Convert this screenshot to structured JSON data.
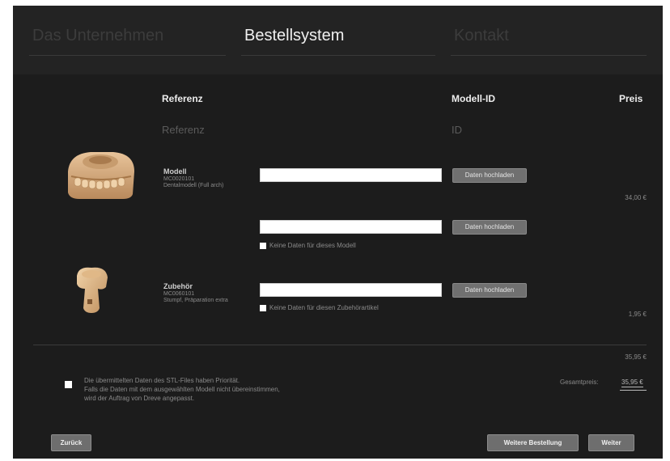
{
  "nav": {
    "tabs": [
      {
        "label": "Das Unternehmen",
        "active": false
      },
      {
        "label": "Bestellsystem",
        "active": true
      },
      {
        "label": "Kontakt",
        "active": false
      }
    ]
  },
  "table": {
    "header": {
      "ref": "Referenz",
      "model_id": "Modell-ID",
      "price": "Preis"
    },
    "sub": {
      "ref": "Referenz",
      "id": "ID"
    }
  },
  "items": [
    {
      "name": "Modell",
      "code": "MC0020101",
      "desc": "Dentalmodell (Full arch)",
      "upload_label": "Daten hochladen",
      "upload_label_2": "Daten hochladen",
      "no_data_label": "Keine Daten für dieses Modell",
      "price": "34,00 €"
    },
    {
      "name": "Zubehör",
      "code": "MC0060101",
      "desc": "Stumpf, Präparation extra",
      "upload_label": "Daten hochladen",
      "no_data_label": "Keine Daten für diesen Zubehörartikel",
      "price": "1,95 €"
    }
  ],
  "summary": {
    "subtotal": "35,95 €",
    "note_lines": [
      "Die übermittelten Daten des STL-Files haben Priorität.",
      "Falls die Daten mit dem ausgewählten Modell nicht übereinstimmen,",
      "wird der Auftrag von Dreve angepasst."
    ],
    "grand_label": "Gesamtpreis:",
    "grand_value": "35,95 €"
  },
  "buttons": {
    "back": "Zurück",
    "more": "Weitere Bestellung",
    "next": "Weiter"
  },
  "colors": {
    "background": "#1c1c1c",
    "nav": "#232323",
    "button": "#6e6e6e"
  }
}
